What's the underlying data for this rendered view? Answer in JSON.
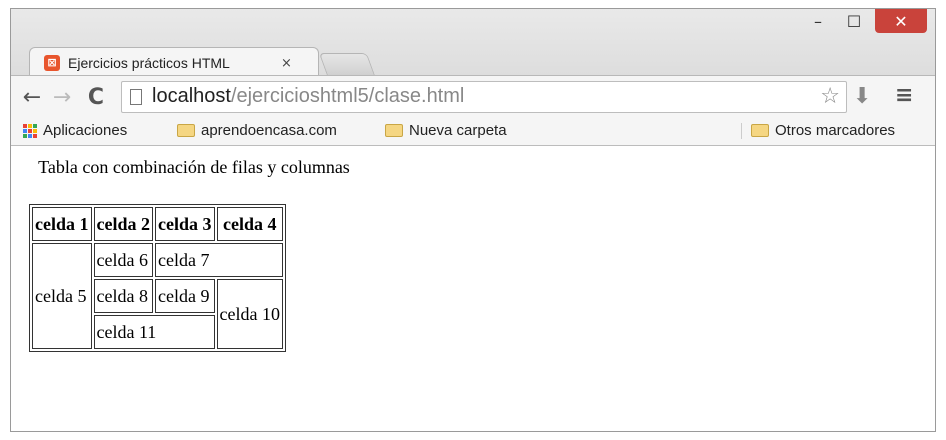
{
  "browser": {
    "tab_title": "Ejercicios prácticos HTML",
    "tab_close": "×",
    "favicon_text": "⊠",
    "window_controls": {
      "minimize": "–",
      "maximize": "☐",
      "close": "✕"
    },
    "nav": {
      "back": "←",
      "forward": "→",
      "reload": "C"
    },
    "url_host": "localhost",
    "url_path": "/ejercicioshtml5/clase.html",
    "star": "☆",
    "menu": "≡",
    "extension": "⬇",
    "bookmarks": [
      "Aplicaciones",
      "aprendoencasa.com",
      "Nueva carpeta"
    ],
    "other_bookmarks": "Otros marcadores",
    "apps_colors": [
      "#e94235",
      "#fbbc04",
      "#34a853",
      "#4285f4",
      "#e94235",
      "#fbbc04",
      "#34a853",
      "#4285f4",
      "#e94235"
    ]
  },
  "page": {
    "caption": "Tabla con combinación de filas y columnas",
    "headers": [
      "celda 1",
      "celda 2",
      "celda 3",
      "celda 4"
    ],
    "cells": {
      "c5": "celda 5",
      "c6": "celda 6",
      "c7": "celda 7",
      "c8": "celda 8",
      "c9": "celda 9",
      "c10": "celda 10",
      "c11": "celda 11"
    }
  }
}
